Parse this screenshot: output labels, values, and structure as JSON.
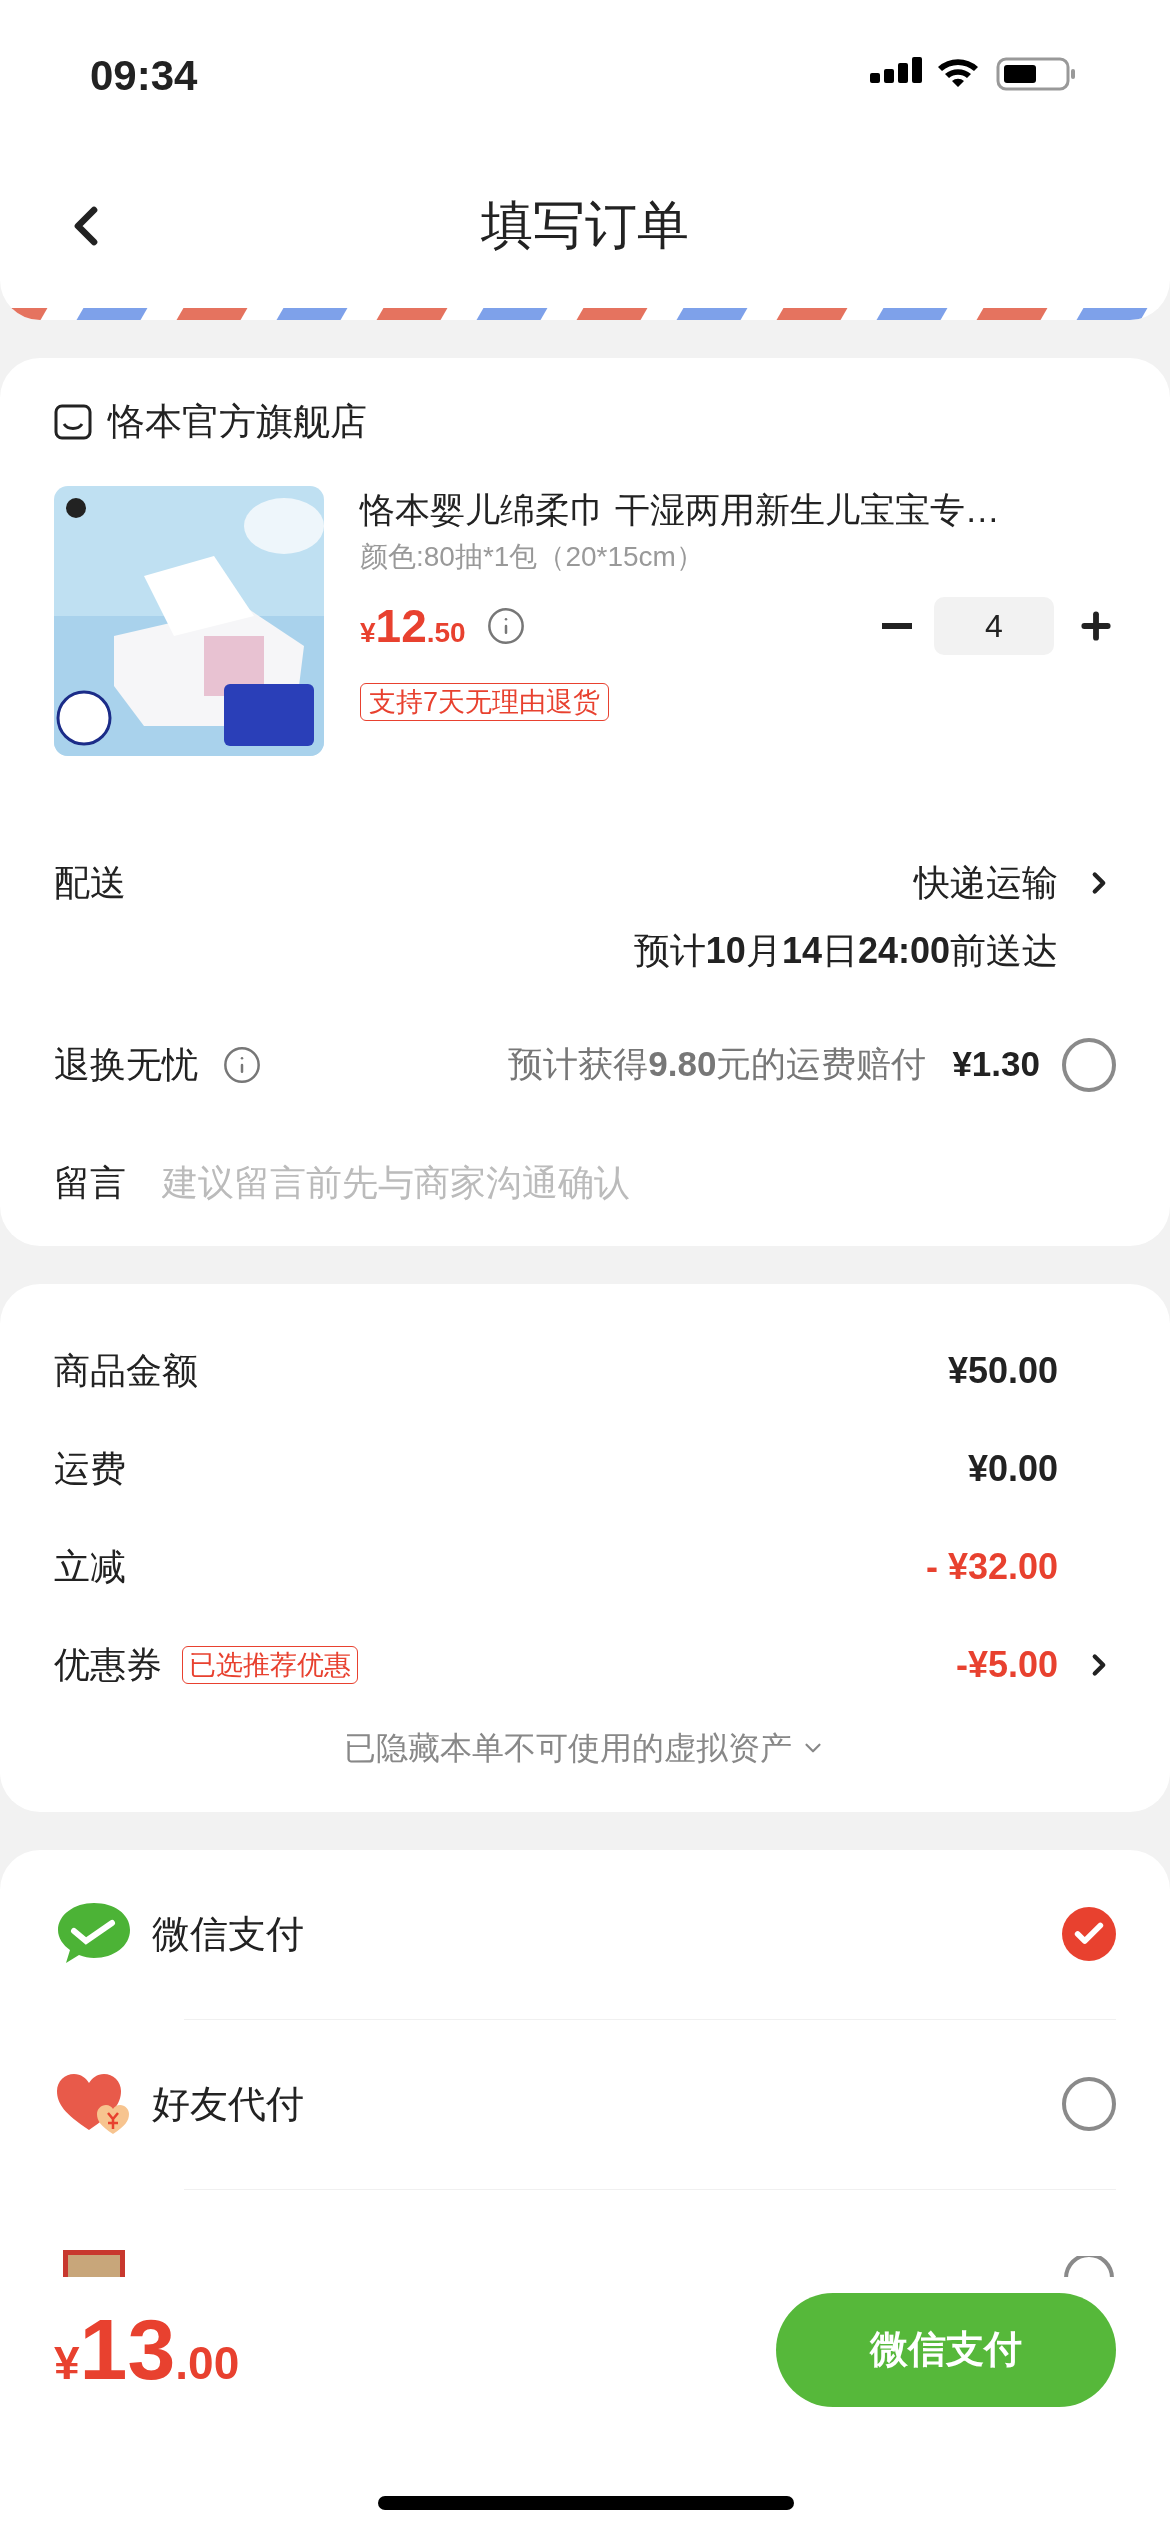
{
  "status_bar": {
    "time": "09:34"
  },
  "header": {
    "title": "填写订单"
  },
  "store": {
    "name": "恪本官方旗舰店"
  },
  "product": {
    "title": "恪本婴儿绵柔巾 干湿两用新生儿宝宝专…",
    "spec": "颜色:80抽*1包（20*15cm）",
    "currency": "¥",
    "price_int": "12",
    "price_dec": ".50",
    "quantity": "4",
    "badge": "支持7天无理由退货"
  },
  "delivery": {
    "label": "配送",
    "method": "快递运输",
    "eta": "预计**10**月**14**日**24:00**前送达"
  },
  "insurance": {
    "label": "退换无忧",
    "note": "预计获得**9.80**元的运费赔付",
    "price": "¥1.30",
    "selected": false
  },
  "message": {
    "label": "留言",
    "placeholder": "建议留言前先与商家沟通确认"
  },
  "summary": [
    {
      "kind": "plain",
      "label": "商品金额",
      "value": "¥50.00"
    },
    {
      "kind": "plain",
      "label": "运费",
      "value": "¥0.00"
    },
    {
      "kind": "discount",
      "label": "立减",
      "value": "- ¥32.00"
    },
    {
      "kind": "coupon",
      "label": "优惠券",
      "tag": "已选推荐优惠",
      "value": "-¥5.00"
    }
  ],
  "hidden_note": "已隐藏本单不可使用的虚拟资产",
  "payments": [
    {
      "kind": "wechat",
      "label": "微信支付",
      "selected": true
    },
    {
      "kind": "friend",
      "label": "好友代付",
      "selected": false
    },
    {
      "kind": "card",
      "selected": false
    }
  ],
  "footer": {
    "currency": "¥",
    "total_int": "13",
    "total_dec": ".00",
    "button": "微信支付"
  }
}
